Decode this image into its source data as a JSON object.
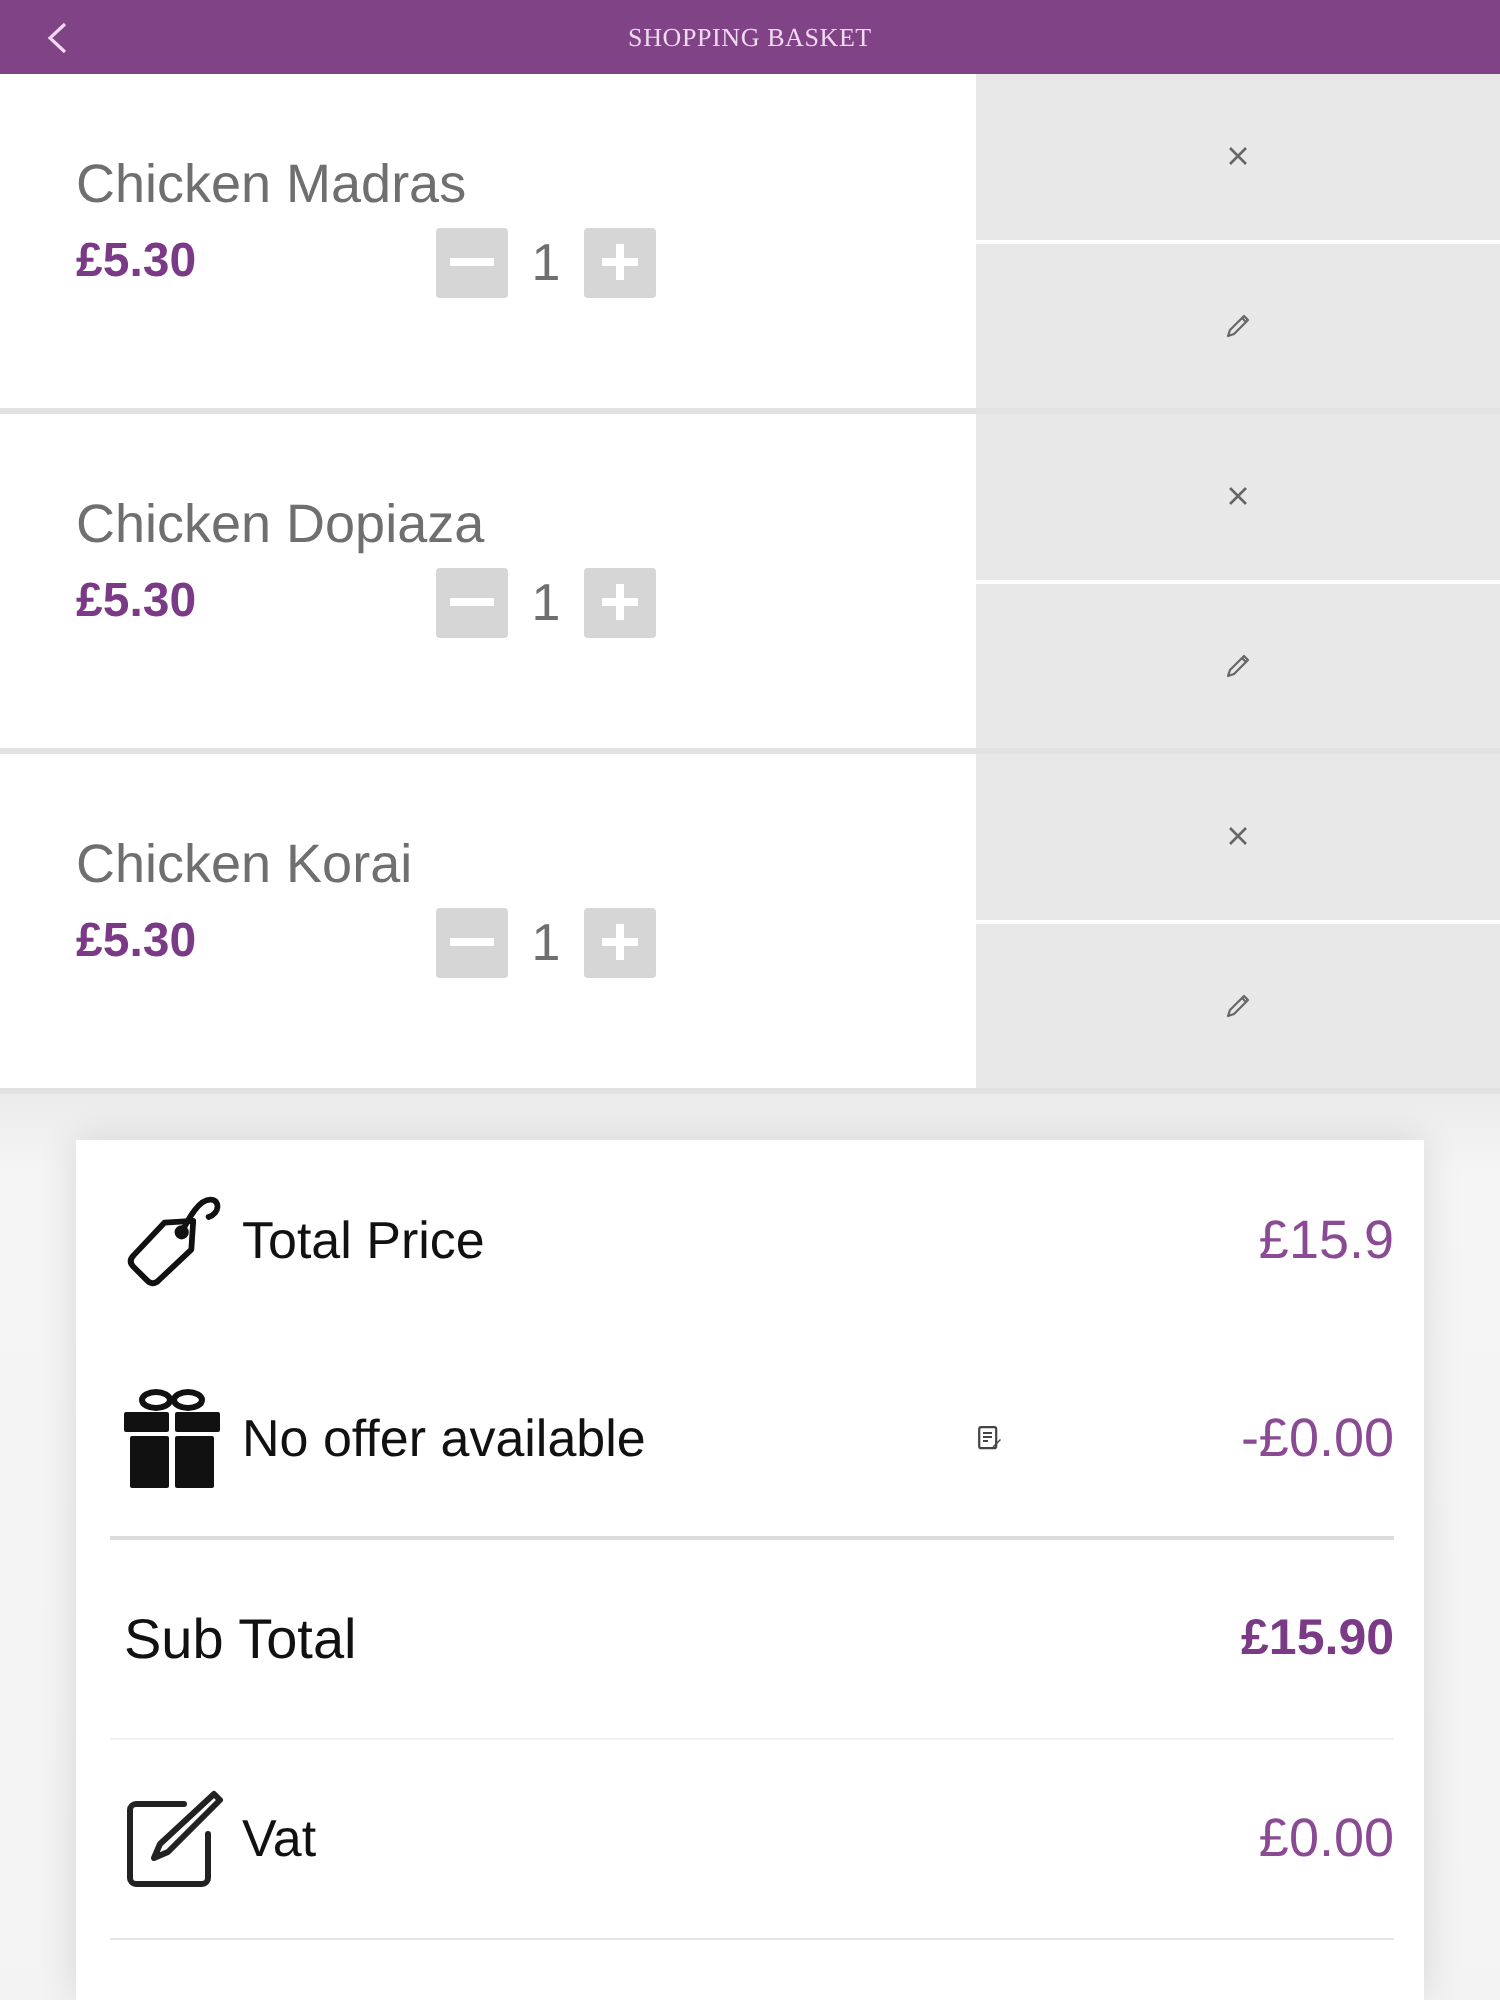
{
  "header": {
    "title": "SHOPPING BASKET"
  },
  "items": [
    {
      "name": "Chicken Madras",
      "price": "£5.30",
      "quantity": "1"
    },
    {
      "name": "Chicken Dopiaza",
      "price": "£5.30",
      "quantity": "1"
    },
    {
      "name": "Chicken Korai",
      "price": "£5.30",
      "quantity": "1"
    }
  ],
  "summary": [
    {
      "kind": "total",
      "label": "Total Price",
      "value": "£15.9"
    },
    {
      "kind": "offer",
      "label": "No offer available",
      "value": "-£0.00"
    },
    {
      "kind": "subtotal",
      "label": "Sub Total",
      "value": "£15.90"
    },
    {
      "kind": "tax",
      "label": "Vat",
      "value": "£0.00"
    }
  ]
}
